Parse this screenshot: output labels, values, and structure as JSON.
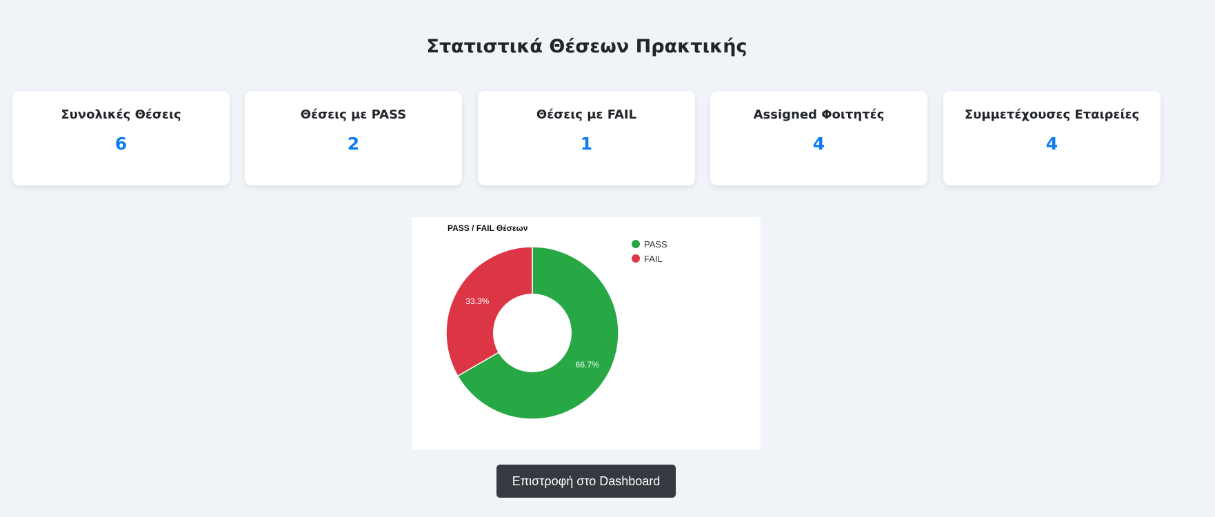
{
  "page": {
    "title": "Στατιστικά Θέσεων Πρακτικής"
  },
  "stats": [
    {
      "label": "Συνολικές Θέσεις",
      "value": "6"
    },
    {
      "label": "Θέσεις με PASS",
      "value": "2"
    },
    {
      "label": "Θέσεις με FAIL",
      "value": "1"
    },
    {
      "label": "Assigned Φοιτητές",
      "value": "4"
    },
    {
      "label": "Συμμετέχουσες Εταιρείες",
      "value": "4"
    }
  ],
  "chart_data": {
    "type": "pie",
    "title": "PASS / FAIL Θέσεων",
    "categories": [
      "PASS",
      "FAIL"
    ],
    "values": [
      2,
      1
    ],
    "labels": [
      "66.7%",
      "33.3%"
    ],
    "colors": [
      "#28a745",
      "#dc3545"
    ],
    "donut": true,
    "legend_position": "top-right"
  },
  "actions": {
    "back_label": "Επιστροφή στο Dashboard"
  }
}
